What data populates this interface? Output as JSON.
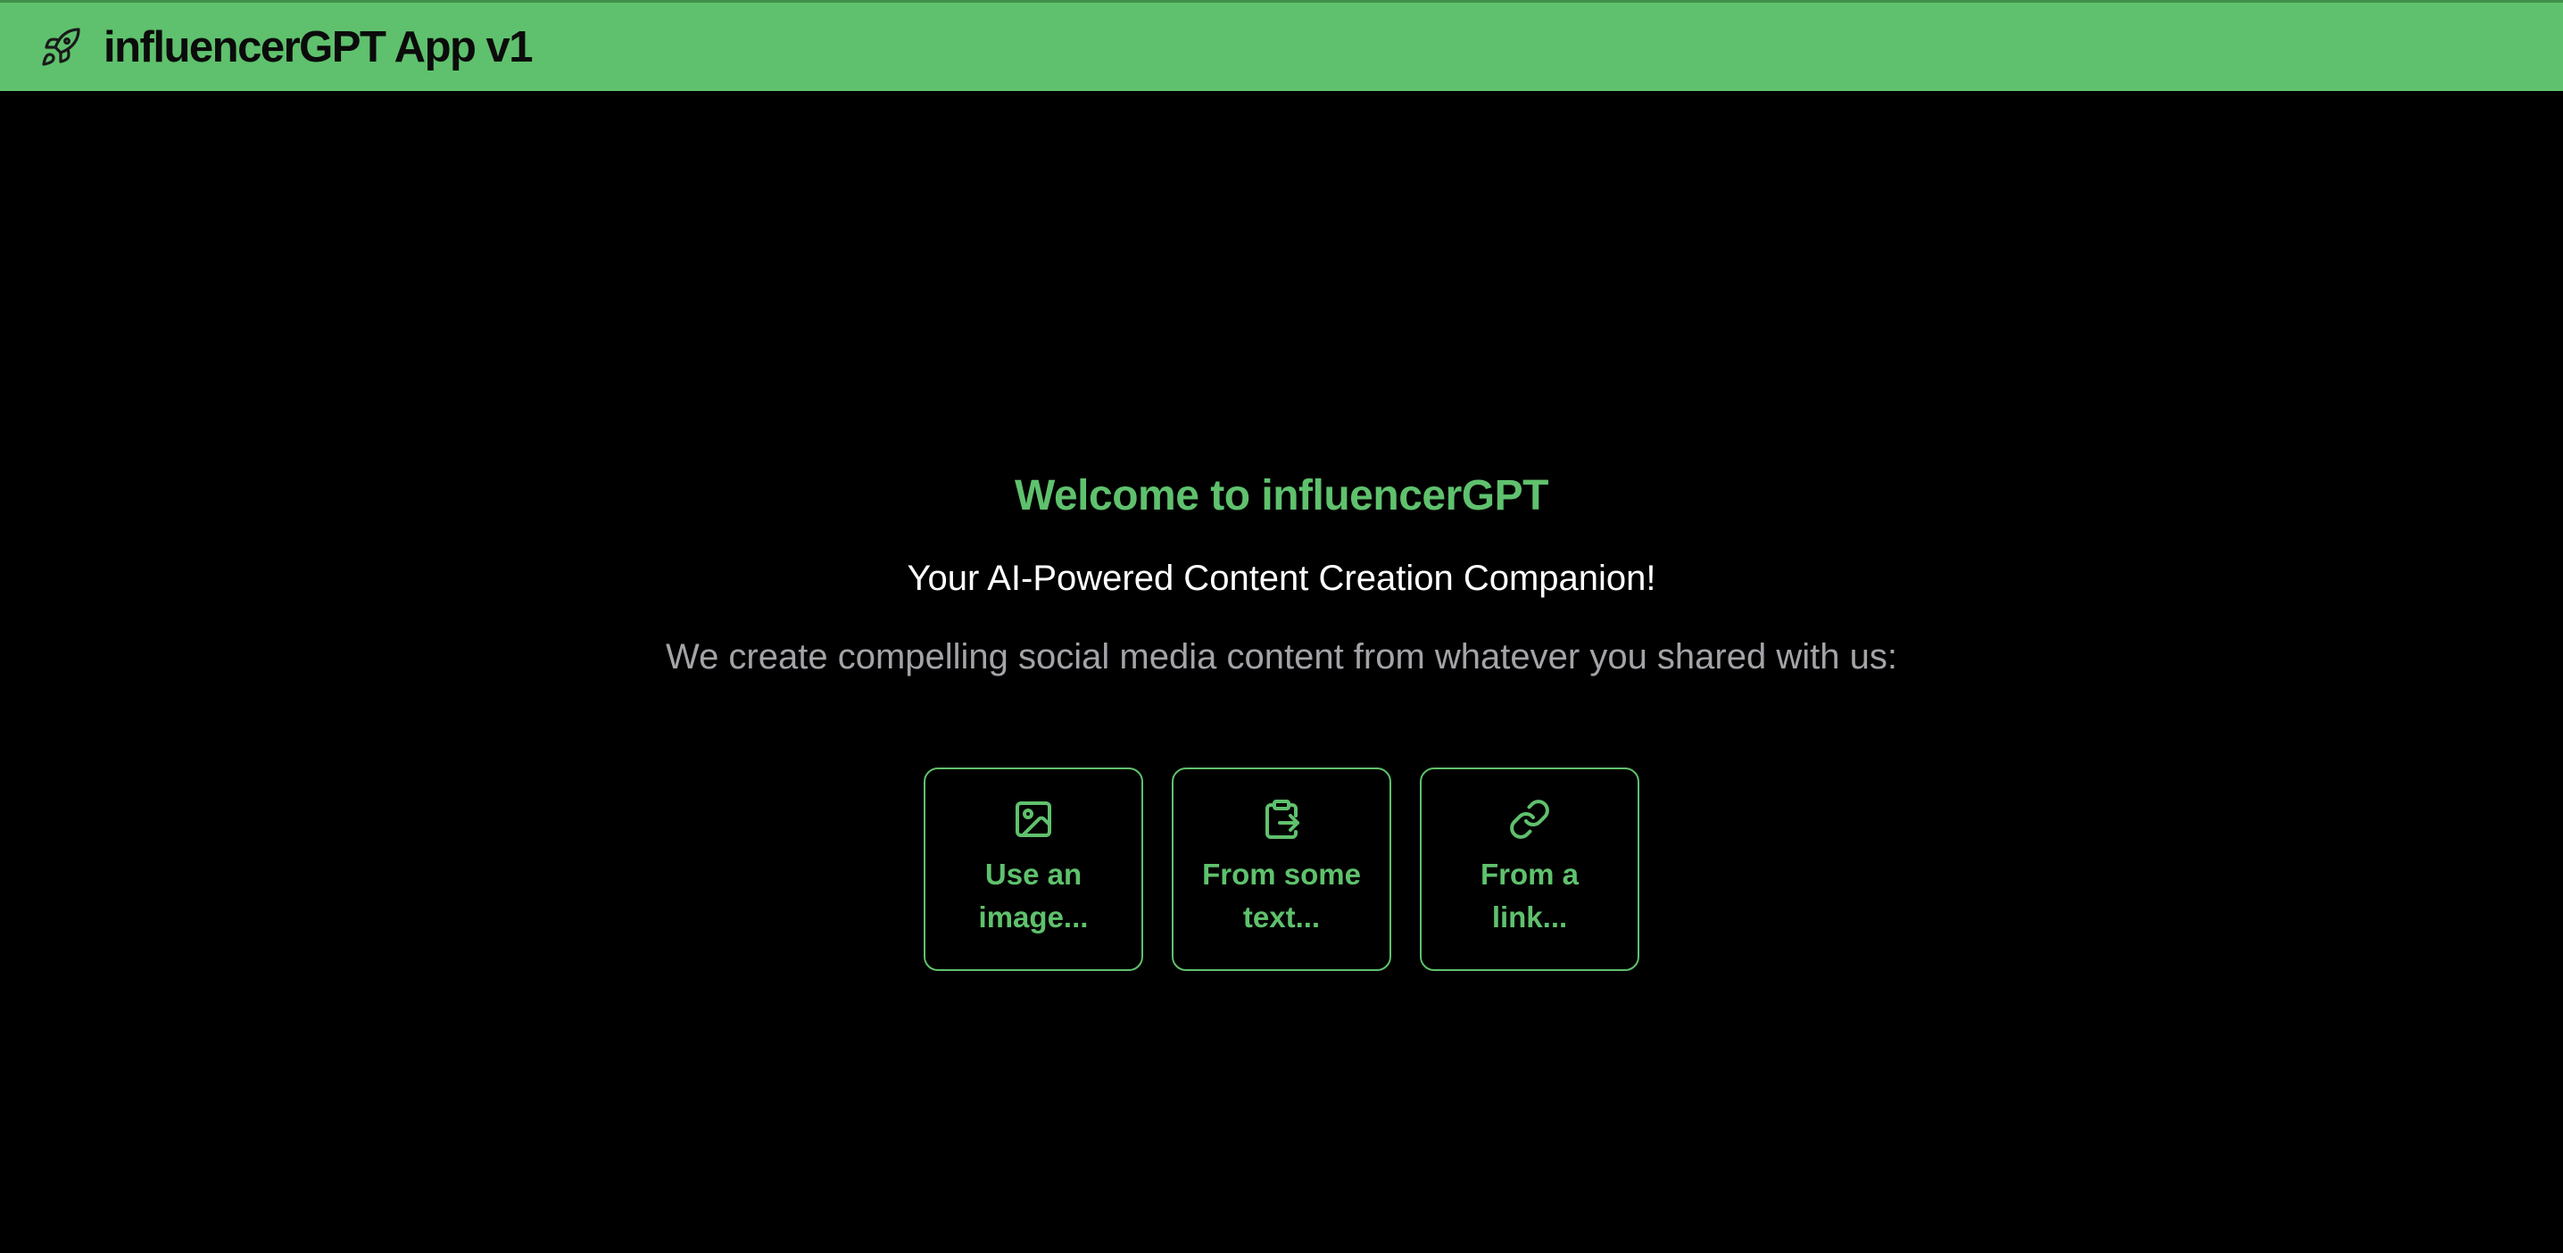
{
  "header": {
    "title": "influencerGPT App v1",
    "icon": "rocket-icon",
    "background_color": "#5fc16d"
  },
  "hero": {
    "welcome": "Welcome to influencerGPT",
    "tagline": "Your AI-Powered Content Creation Companion!",
    "description": "We create compelling social media content from whatever you shared with us:"
  },
  "options": [
    {
      "label": "Use an image...",
      "icon": "image-icon"
    },
    {
      "label": "From some text...",
      "icon": "clipboard-icon"
    },
    {
      "label": "From a link...",
      "icon": "link-icon"
    }
  ],
  "colors": {
    "accent": "#5fc16d",
    "background": "#000000",
    "muted_text": "#a3a3a8"
  }
}
